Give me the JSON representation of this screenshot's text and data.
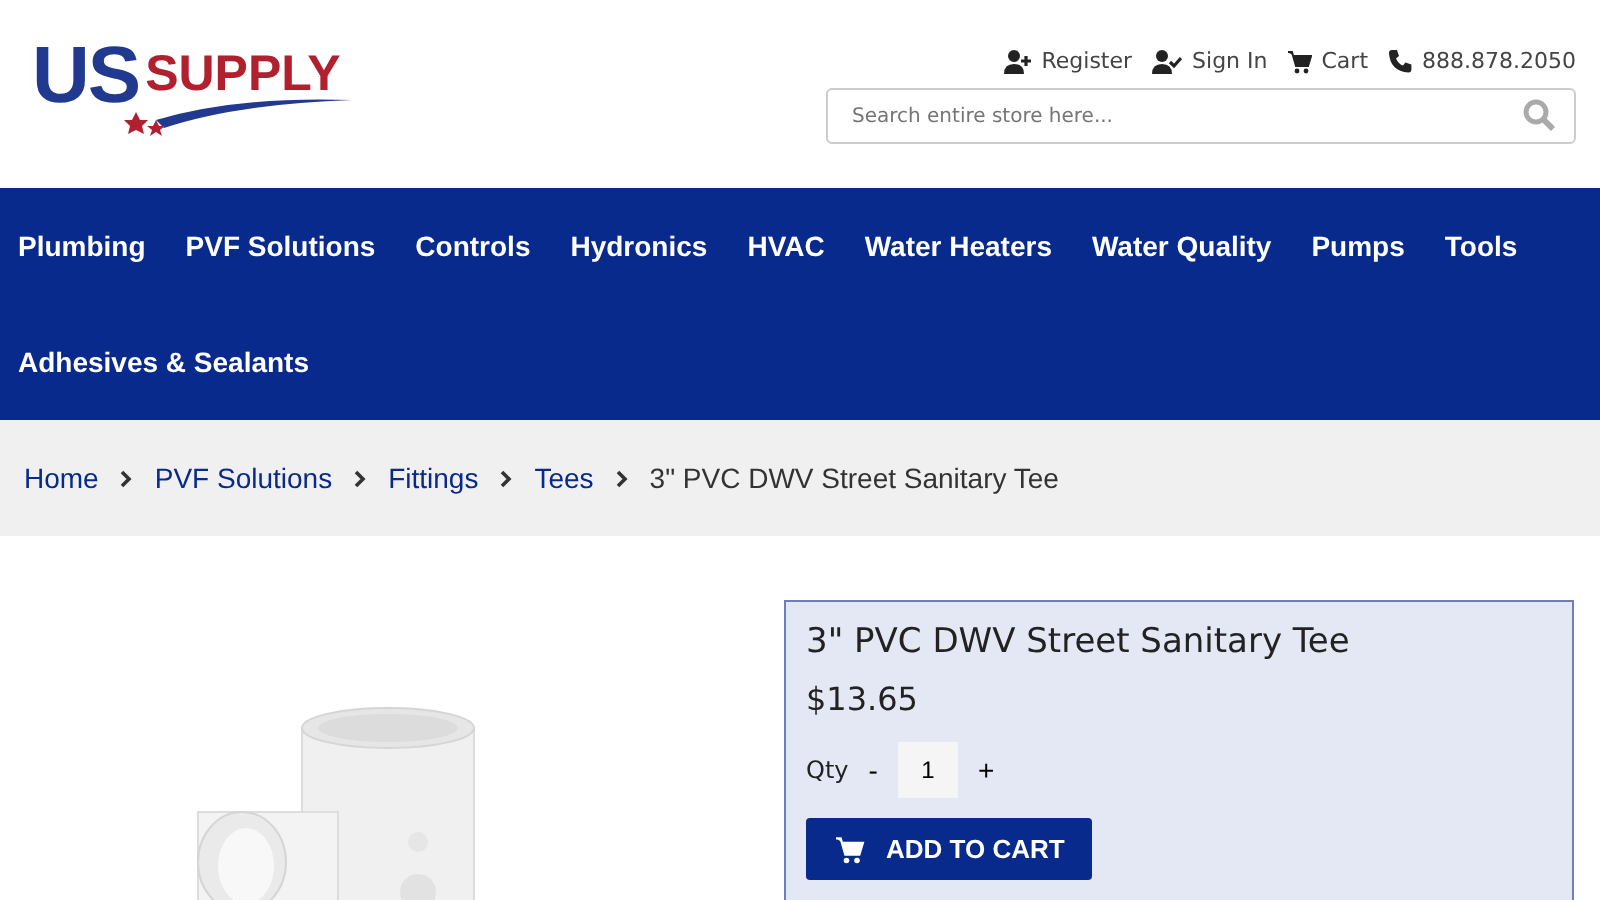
{
  "header": {
    "logo": {
      "us": "US",
      "supply": "SUPPLY"
    },
    "top_links": [
      {
        "kind": "register",
        "label": "Register"
      },
      {
        "kind": "signin",
        "label": "Sign In"
      },
      {
        "kind": "cart",
        "label": "Cart"
      },
      {
        "kind": "phone",
        "label": "888.878.2050"
      }
    ],
    "search": {
      "placeholder": "Search entire store here..."
    }
  },
  "nav": {
    "items": [
      "Plumbing",
      "PVF Solutions",
      "Controls",
      "Hydronics",
      "HVAC",
      "Water Heaters",
      "Water Quality",
      "Pumps",
      "Tools",
      "Adhesives & Sealants"
    ]
  },
  "breadcrumb": {
    "links": [
      "Home",
      "PVF Solutions",
      "Fittings",
      "Tees"
    ],
    "current": "3\" PVC DWV Street Sanitary Tee"
  },
  "product": {
    "title": "3\" PVC DWV Street Sanitary Tee",
    "price": "$13.65",
    "qty_label": "Qty",
    "minus": "-",
    "qty": "1",
    "plus": "+",
    "add_button": "ADD TO CART"
  }
}
